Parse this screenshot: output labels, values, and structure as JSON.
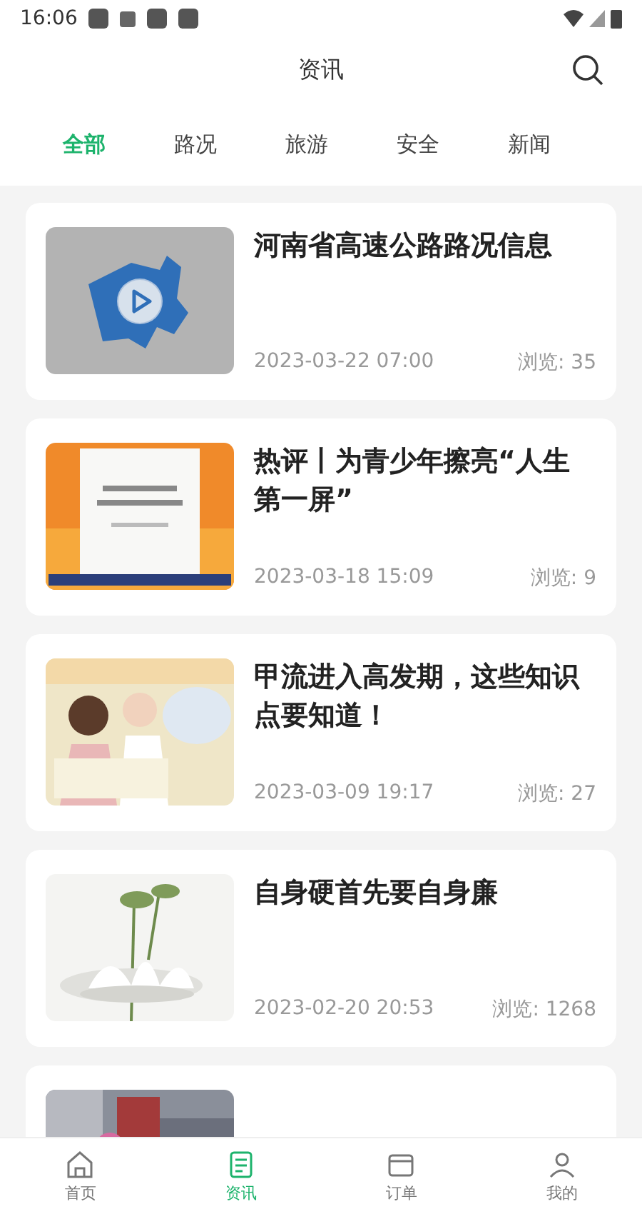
{
  "status_bar": {
    "time": "16:06"
  },
  "header": {
    "title": "资讯"
  },
  "tabs": [
    {
      "label": "全部",
      "selected": true
    },
    {
      "label": "路况",
      "selected": false
    },
    {
      "label": "旅游",
      "selected": false
    },
    {
      "label": "安全",
      "selected": false
    },
    {
      "label": "新闻",
      "selected": false
    }
  ],
  "articles": [
    {
      "thumb": {
        "kind": "picture",
        "video": true
      },
      "title": "河南省高速公路路况信息",
      "date": "2023-03-22 07:00",
      "views": "浏览: 35"
    },
    {
      "thumb": {
        "kind": "picture",
        "video": false
      },
      "title": "热评丨为青少年擦亮“人生第一屏”",
      "date": "2023-03-18 15:09",
      "views": "浏览: 9"
    },
    {
      "thumb": {
        "kind": "picture",
        "video": false
      },
      "title": "甲流进入高发期，这些知识点要知道！",
      "date": "2023-03-09 19:17",
      "views": "浏览: 27"
    },
    {
      "thumb": {
        "kind": "picture",
        "video": false
      },
      "title": "自身硬首先要自身廉",
      "date": "2023-02-20 20:53",
      "views": "浏览: 1268"
    },
    {
      "thumb": {
        "kind": "picture"
      }
    }
  ],
  "bottom_nav": [
    {
      "label": "首页",
      "selected": false
    },
    {
      "label": "资讯",
      "selected": true
    },
    {
      "label": "订单",
      "selected": false
    },
    {
      "label": "我的",
      "selected": false
    }
  ]
}
